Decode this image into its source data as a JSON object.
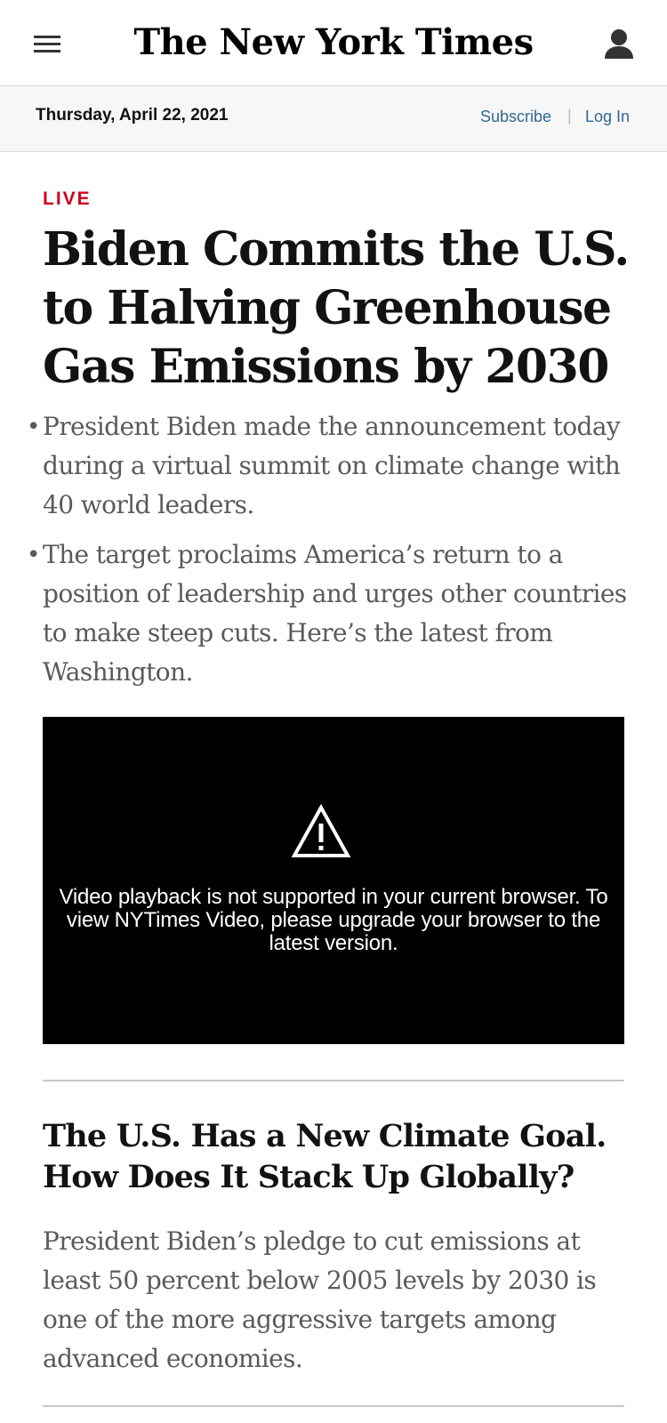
{
  "header": {
    "logo_text": "The New York Times",
    "menu_icon": "hamburger-menu-icon",
    "account_icon": "user-account-icon"
  },
  "datebar": {
    "date": "Thursday, April 22, 2021",
    "subscribe_label": "Subscribe",
    "separator": "|",
    "login_label": "Log In"
  },
  "article": {
    "live_label": "LIVE",
    "headline": "Biden Commits the U.S. to Halving Greenhouse Gas Emissions by 2030",
    "bullets": [
      "President Biden made the announcement today during a virtual summit on climate change with 40 world leaders.",
      "The target proclaims America’s return to a position of leadership and urges other countries to make steep cuts. Here’s the latest from Washington."
    ],
    "video": {
      "warning_icon": "warning-triangle-icon",
      "message": "Video playback is not supported in your current browser. To view NYTimes Video, please upgrade your browser to the latest version."
    }
  },
  "related_story": {
    "title": "The U.S. Has a New Climate Goal. How Does It Stack Up Globally?",
    "summary": "President Biden’s pledge to cut emissions at least 50 percent below 2005 levels by 2030 is one of the more aggressive targets among advanced economies."
  },
  "colors": {
    "live_red": "#d0021b",
    "link_blue": "#326891",
    "summary_gray": "#5a5a5a",
    "datebar_bg": "#f7f7f7"
  }
}
